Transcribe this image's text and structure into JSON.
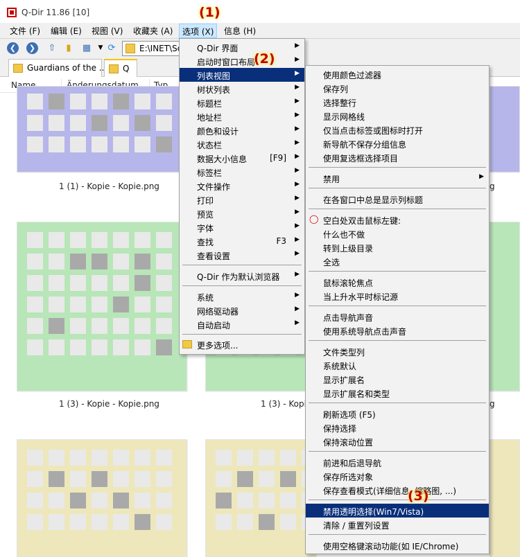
{
  "window": {
    "title": "Q-Dir 11.86 [10]"
  },
  "markers": [
    "(1)",
    "(2)",
    "(3)"
  ],
  "menubar": [
    {
      "label": "文件 (F)"
    },
    {
      "label": "编辑 (E)"
    },
    {
      "label": "视图 (V)"
    },
    {
      "label": "收藏夹 (A)"
    },
    {
      "label": "选项 (X)",
      "active": true
    },
    {
      "label": "信息 (H)"
    }
  ],
  "toolbar": {
    "back_icon": "arrow-left-icon",
    "forward_icon": "arrow-right-icon",
    "address": "E:\\INET\\So"
  },
  "tabs": [
    {
      "label": "Guardians of the ..."
    },
    {
      "label": "Q",
      "active": true
    }
  ],
  "columns": [
    "Name",
    "Änderungsdatum",
    "Typ"
  ],
  "thumbnails": [
    {
      "caption": "1 (1) - Kopie - Kopie.png",
      "color": "#b6b6ea"
    },
    {
      "caption": "1 (3) - Kopie - Kopie.png",
      "color": "#b8e6b8"
    },
    {
      "caption": "1 (3) - Kopie",
      "color": "#b8e6b8"
    },
    {
      "caption": "g",
      "color": "#b6b6ea"
    },
    {
      "caption": "g",
      "color": "#b8e6b8"
    }
  ],
  "options_menu": {
    "items": [
      {
        "label": "Q-Dir 界面",
        "submenu": true
      },
      {
        "label": "启动时窗口布局",
        "submenu": true
      },
      {
        "label": "列表视图",
        "submenu": true,
        "highlighted": true
      },
      {
        "label": "树状列表",
        "submenu": true
      },
      {
        "label": "标题栏",
        "submenu": true
      },
      {
        "label": "地址栏",
        "submenu": true
      },
      {
        "label": "颜色和设计",
        "submenu": true
      },
      {
        "label": "状态栏",
        "submenu": true
      },
      {
        "label": "数据大小信息",
        "shortcut": "[F9]",
        "submenu": true
      },
      {
        "label": "标签栏",
        "submenu": true
      },
      {
        "label": "文件操作",
        "submenu": true
      },
      {
        "label": "打印",
        "submenu": true
      },
      {
        "label": "预览",
        "submenu": true
      },
      {
        "label": "字体",
        "submenu": true
      },
      {
        "label": "查找",
        "shortcut": "F3",
        "submenu": true
      },
      {
        "label": "查看设置",
        "submenu": true
      },
      {
        "label": "Q-Dir 作为默认浏览器",
        "submenu": true
      },
      {
        "label": "系统",
        "submenu": true
      },
      {
        "label": "网络驱动器",
        "submenu": true
      },
      {
        "label": "自动启动",
        "submenu": true
      },
      {
        "label": "更多选项..."
      }
    ]
  },
  "listview_menu": {
    "items": [
      {
        "label": "使用颜色过滤器"
      },
      {
        "label": "保存列"
      },
      {
        "label": "选择整行"
      },
      {
        "label": "显示网格线"
      },
      {
        "label": "仅当点击标签或图标时打开"
      },
      {
        "label": "新导航不保存分组信息"
      },
      {
        "label": "使用复选框选择项目"
      },
      {
        "label": "禁用",
        "submenu": true
      },
      {
        "label": "在各窗口中总是显示列标题"
      },
      {
        "label": "空白处双击鼠标左键:"
      },
      {
        "label": "什么也不做"
      },
      {
        "label": "转到上级目录"
      },
      {
        "label": "全选"
      },
      {
        "label": "鼠标滚轮焦点"
      },
      {
        "label": "当上升水平时标记源"
      },
      {
        "label": "点击导航声音"
      },
      {
        "label": "使用系统导航点击声音"
      },
      {
        "label": "文件类型列"
      },
      {
        "label": "系统默认"
      },
      {
        "label": "显示扩展名"
      },
      {
        "label": "显示扩展名和类型"
      },
      {
        "label": "刷新选项 (F5)"
      },
      {
        "label": "保持选择"
      },
      {
        "label": "保持滚动位置"
      },
      {
        "label": "前进和后退导航"
      },
      {
        "label": "保存所选对象"
      },
      {
        "label": "保存查看模式(详细信息, 缩略图, ...)"
      },
      {
        "label": "禁用透明选择(Win7/Vista)",
        "highlighted": true
      },
      {
        "label": "清除 / 重置列设置"
      },
      {
        "label": "使用空格键滚动功能(如 IE/Chrome)"
      }
    ]
  }
}
